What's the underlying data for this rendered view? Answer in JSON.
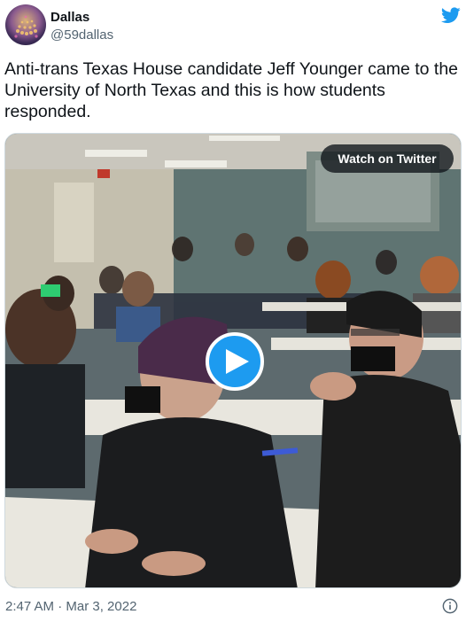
{
  "author": {
    "display_name": "Dallas",
    "handle": "@59dallas"
  },
  "tweet": {
    "text": "Anti-trans Texas House candidate Jeff Younger came to the University of North Texas and this is how students responded."
  },
  "media": {
    "watch_label": "Watch on Twitter"
  },
  "meta": {
    "timestamp": "2:47 AM · Mar 3, 2022"
  },
  "icons": {
    "brand": "twitter-bird-icon",
    "play": "play-icon",
    "info": "info-icon"
  },
  "colors": {
    "accent": "#1d9bf0",
    "text": "#0f1419",
    "secondary": "#536471"
  }
}
